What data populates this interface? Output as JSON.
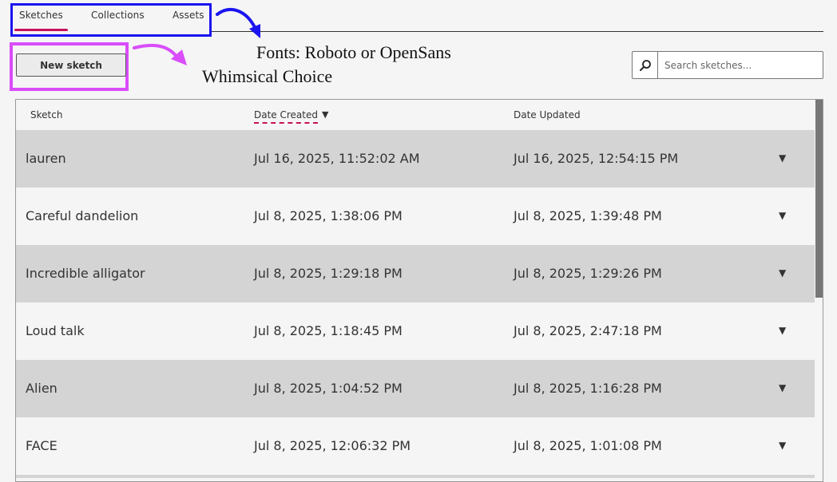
{
  "tabs": [
    {
      "label": "Sketches",
      "active": true
    },
    {
      "label": "Collections",
      "active": false
    },
    {
      "label": "Assets",
      "active": false
    }
  ],
  "toolbar": {
    "new_sketch_label": "New sketch"
  },
  "annotations": {
    "line1": "Fonts: Roboto or OpenSans",
    "line2": "Whimsical Choice",
    "box_colors": {
      "tabs_box": "#1a14f0",
      "button_box": "#d94dfa"
    }
  },
  "search": {
    "placeholder": "Search sketches...",
    "value": "",
    "icon": "search-icon"
  },
  "table": {
    "columns": [
      "Sketch",
      "Date Created",
      "Date Updated"
    ],
    "sorted_column": "Date Created",
    "sort_direction": "descending",
    "rows": [
      {
        "name": "lauren",
        "created": "Jul 16, 2025, 11:52:02 AM",
        "updated": "Jul 16, 2025, 12:54:15 PM"
      },
      {
        "name": "Careful dandelion",
        "created": "Jul 8, 2025, 1:38:06 PM",
        "updated": "Jul 8, 2025, 1:39:48 PM"
      },
      {
        "name": "Incredible alligator",
        "created": "Jul 8, 2025, 1:29:18 PM",
        "updated": "Jul 8, 2025, 1:29:26 PM"
      },
      {
        "name": "Loud talk",
        "created": "Jul 8, 2025, 1:18:45 PM",
        "updated": "Jul 8, 2025, 2:47:18 PM"
      },
      {
        "name": "Alien",
        "created": "Jul 8, 2025, 1:04:52 PM",
        "updated": "Jul 8, 2025, 1:16:28 PM"
      },
      {
        "name": "FACE",
        "created": "Jul 8, 2025, 12:06:32 PM",
        "updated": "Jul 8, 2025, 1:01:08 PM"
      }
    ],
    "row_caret": "▼"
  },
  "colors": {
    "accent": "#c8105a",
    "row_shade": "#d4d4d4",
    "background": "#f5f5f5"
  }
}
